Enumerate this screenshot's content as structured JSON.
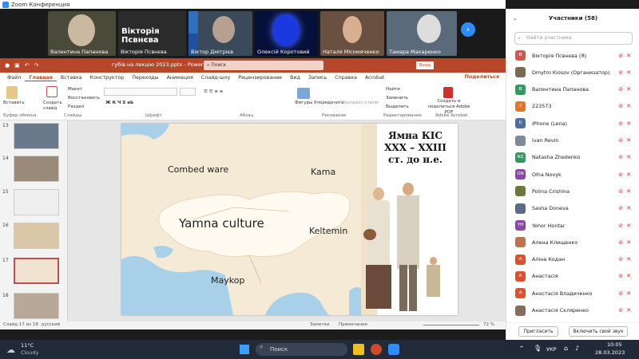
{
  "window_title": "Zoom Конференция",
  "gallery": {
    "tiles": [
      {
        "name": "Валентина Папанова",
        "bg": "#4a4a3a"
      },
      {
        "name": "Вікторія Псвнєва",
        "bg": "#2b2b2b",
        "big": "Вікторія Псвнєва"
      },
      {
        "name": "Віктор Дмітрієв",
        "bg": "#3a4a5a"
      },
      {
        "name": "Олексій Коротовий",
        "bg": "#0a1a6a"
      },
      {
        "name": "Наталя Місомяченко",
        "bg": "#6a5040"
      },
      {
        "name": "Тамара Макаренко",
        "bg": "#5a6a7a"
      }
    ],
    "next_icon": "chevron-right-icon"
  },
  "ppt": {
    "filename": "губів на лекцію 2023.pptx - PowerPoint",
    "search_placeholder": "Поиск",
    "user_badge": "Вход",
    "share_label": "Поделиться",
    "tabs": [
      "Файл",
      "Главная",
      "Вставка",
      "Конструктор",
      "Переходы",
      "Анимация",
      "Слайд-шоу",
      "Рецензирование",
      "Вид",
      "Запись",
      "Справка",
      "Acrobat"
    ],
    "active_tab": "Главная",
    "ribbon": {
      "groups": [
        "Буфер обмена",
        "Слайды",
        "Шрифт",
        "Абзац",
        "Рисование",
        "Редактирование",
        "Adobe Acrobat"
      ],
      "paste": "Вставить",
      "new_slide": "Создать слайд",
      "layout": "Макет",
      "reset": "Восстановить",
      "section": "Раздел",
      "shapes": "Фигуры",
      "arrange": "Упорядочить",
      "quick_styles": "Экспресс-стили",
      "find": "Найти",
      "replace": "Заменить",
      "select": "Выделить",
      "adobe": "Создать и поделиться Adobe PDF"
    },
    "thumbnails": [
      "13",
      "14",
      "15",
      "16",
      "17",
      "18"
    ],
    "selected_slide": "17",
    "slide": {
      "map_labels": {
        "combed": "Combed ware",
        "kama": "Kama",
        "yamna": "Yamna culture",
        "keltemin": "Keltemin",
        "maykop": "Maykop"
      },
      "title_line1": "Ямна КІС",
      "title_line2": "XXX – XXIII",
      "title_line3": "ст. до н.е."
    },
    "status": {
      "slide_of": "Слайд 17 из 18",
      "language": "русский",
      "notes": "Заметки",
      "comments": "Примечания",
      "zoom": "72 %"
    }
  },
  "participants": {
    "header": "Участники (58)",
    "search_placeholder": "Найти участника",
    "list": [
      {
        "initials": "В",
        "name": "Вікторія Псвнєва (Я)",
        "color": "#d9534f"
      },
      {
        "initials": "",
        "name": "Dmytro Kiosov (Организатор)",
        "color": "#7a6a50"
      },
      {
        "initials": "В",
        "name": "Валентина Папанова",
        "color": "#2e9c5e"
      },
      {
        "initials": "2",
        "name": "223573",
        "color": "#e8742c"
      },
      {
        "initials": "I(",
        "name": "iPhone (Lena)",
        "color": "#4a6fa5"
      },
      {
        "initials": "",
        "name": "Ivan Revin",
        "color": "#7a8a9a"
      },
      {
        "initials": "NZ",
        "name": "Natasha Zhedenko",
        "color": "#2e9c5e"
      },
      {
        "initials": "ON",
        "name": "Olha Novyk",
        "color": "#8e44ad"
      },
      {
        "initials": "",
        "name": "Polina Crishina",
        "color": "#6a7a3a"
      },
      {
        "initials": "",
        "name": "Sasha Doneva",
        "color": "#5a6a8a"
      },
      {
        "initials": "YH",
        "name": "Yehor Hontar",
        "color": "#8e44ad"
      },
      {
        "initials": "",
        "name": "Алена Клищенко",
        "color": "#c0704a"
      },
      {
        "initials": "А",
        "name": "Аліна Кодан",
        "color": "#e0502c"
      },
      {
        "initials": "А",
        "name": "Анастасія",
        "color": "#e0502c"
      },
      {
        "initials": "А",
        "name": "Анастасія Владиченко",
        "color": "#e0502c"
      },
      {
        "initials": "",
        "name": "Анастасія Скляренко",
        "color": "#8a6a5a"
      }
    ],
    "invite_label": "Пригласить",
    "unmute_label": "Включить свой звук"
  },
  "taskbar": {
    "weather_temp": "11°C",
    "weather_desc": "Cloudy",
    "search_label": "Поиск",
    "lang": "УКР",
    "time": "10:05",
    "date": "28.03.2023"
  }
}
